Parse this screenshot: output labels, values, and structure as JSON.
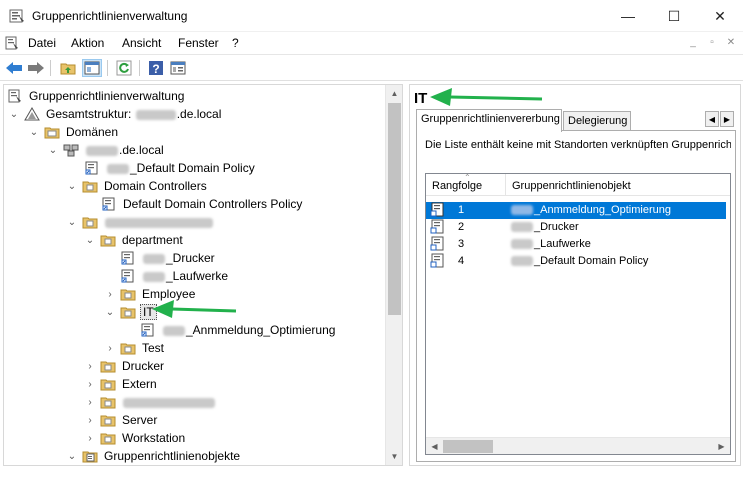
{
  "window": {
    "title": "Gruppenrichtlinienverwaltung",
    "minimize_glyph": "—",
    "maximize_glyph": "☐",
    "close_glyph": "✕"
  },
  "menu": {
    "items": [
      "Datei",
      "Aktion",
      "Ansicht",
      "Fenster",
      "?"
    ],
    "mdi_minimize": "_",
    "mdi_restore": "▫",
    "mdi_close": "✕"
  },
  "toolbar": {
    "icons": [
      "back-arrow-icon",
      "forward-arrow-icon",
      "folder-up-icon",
      "show-hide-tree-icon",
      "refresh-icon",
      "help-icon",
      "properties-icon"
    ]
  },
  "tree": {
    "root": "Gruppenrichtlinienverwaltung",
    "forest": "Gesamtstruktur:",
    "forest_domain_suffix": ".de.local",
    "domains": "Domänen",
    "domain_suffix": ".de.local",
    "default_domain_policy": "_Default Domain Policy",
    "domain_controllers": "Domain Controllers",
    "default_dc_policy": "Default Domain Controllers Policy",
    "department": "department",
    "drucker_link": "_Drucker",
    "laufwerke_link": "_Laufwerke",
    "employee": "Employee",
    "it": "IT",
    "anmeldung_link": "_Anmmeldung_Optimierung",
    "test": "Test",
    "drucker_ou": "Drucker",
    "extern": "Extern",
    "server": "Server",
    "workstation": "Workstation",
    "gpo_container": "Gruppenrichtlinienobjekte"
  },
  "right_pane": {
    "title": "IT",
    "tabs": [
      "Gruppenrichtlinienvererbung",
      "Delegierung"
    ],
    "info_text": "Die Liste enthält keine mit Standorten verknüpften Gruppenrichtlin",
    "columns": [
      "Rangfolge",
      "Gruppenrichtlinienobjekt"
    ],
    "rows": [
      {
        "rank": "1",
        "gpo": "_Anmmeldung_Optimierung",
        "selected": true
      },
      {
        "rank": "2",
        "gpo": "_Drucker",
        "selected": false
      },
      {
        "rank": "3",
        "gpo": "_Laufwerke",
        "selected": false
      },
      {
        "rank": "4",
        "gpo": "_Default Domain Policy",
        "selected": false
      }
    ]
  },
  "colors": {
    "selection": "#0078d7",
    "annotation_arrow": "#22b14c",
    "folder": "#e8c36a"
  }
}
